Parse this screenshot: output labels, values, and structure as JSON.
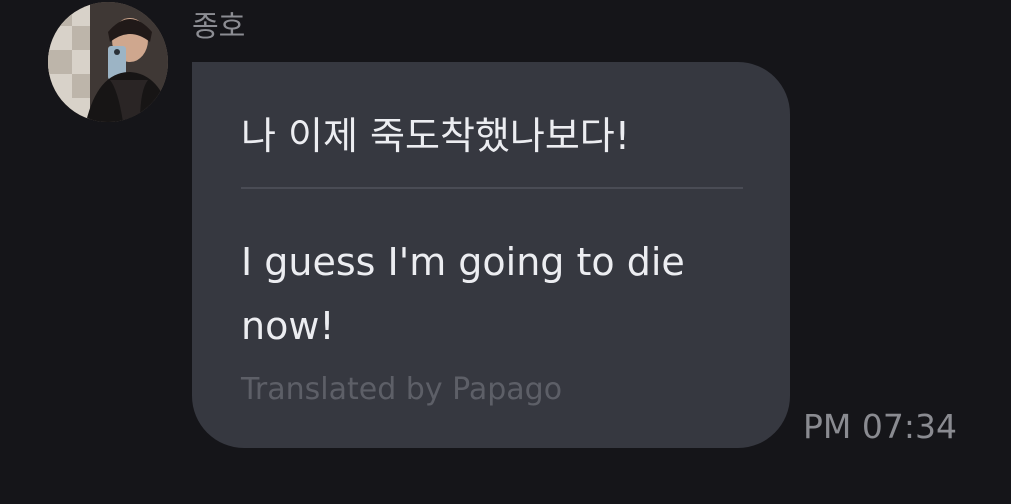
{
  "message": {
    "sender_name": "종호",
    "original_text": "나 이제 죽도착했나보다!",
    "translated_text": "I guess I'm going to die now!",
    "translator_credit": "Translated by Papago",
    "timestamp": "PM 07:34"
  },
  "avatar": {
    "icon": "profile-photo"
  },
  "colors": {
    "background": "#151519",
    "bubble": "#363840",
    "primary_text": "#ecedf1",
    "secondary_text": "#8a8b91",
    "credit_text": "#5d5f67"
  }
}
